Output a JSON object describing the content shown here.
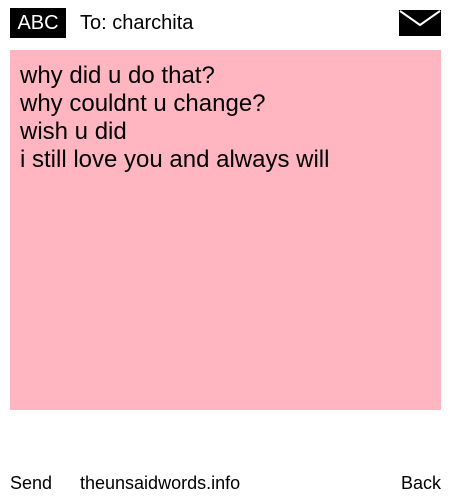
{
  "header": {
    "badge_label": "ABC",
    "to_line": "To: charchita",
    "envelope_icon": "envelope-icon"
  },
  "message": {
    "background_color": "#ffb6c1",
    "lines": [
      "why did u do that?",
      "why couldnt u change?",
      "wish u did",
      "i still love you and always will"
    ]
  },
  "footer": {
    "send_label": "Send",
    "site_label": "theunsaidwords.info",
    "back_label": "Back"
  }
}
